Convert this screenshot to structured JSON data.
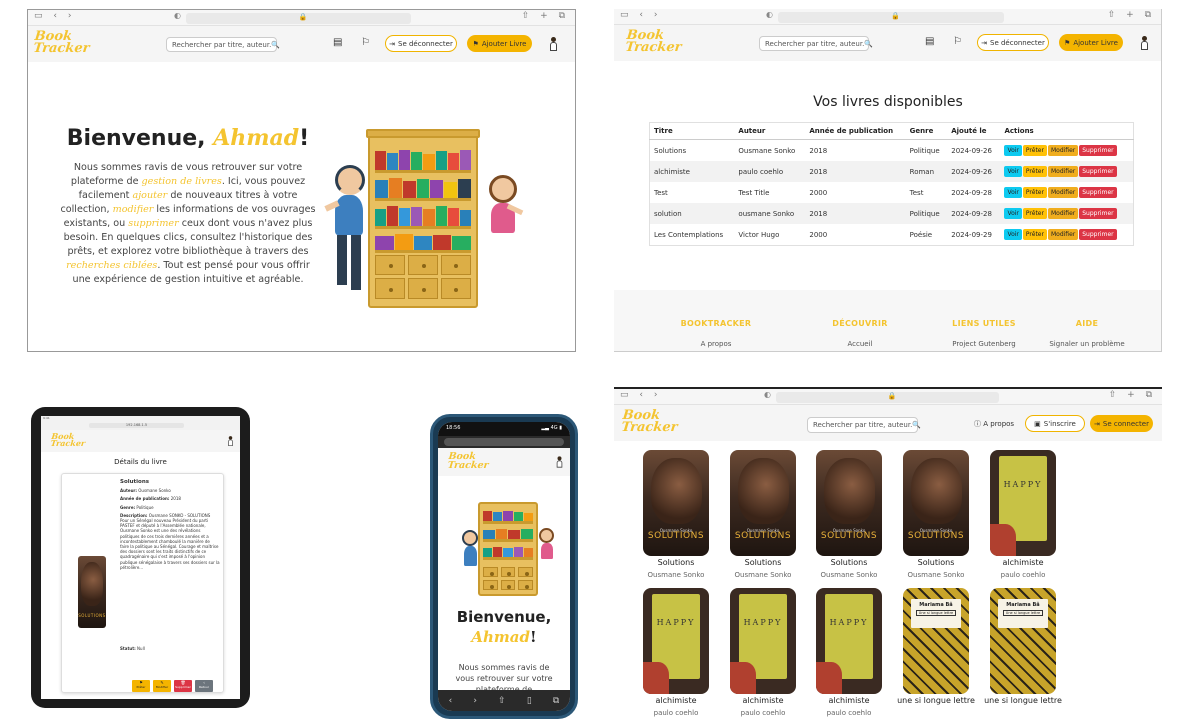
{
  "brand": {
    "logo_line1": "Book",
    "logo_line2": "Tracker",
    "accent": "#f4c430"
  },
  "nav": {
    "search_placeholder": "Rechercher par titre, auteur..",
    "search_placeholder_short": "Rechercher par titre, auteur.",
    "logout_label": "Se déconnecter",
    "add_book_label": "Ajouter Livre",
    "about_label": "A propos",
    "signup_label": "S'inscrire",
    "login_label": "Se connecter"
  },
  "home": {
    "greeting": "Bienvenue, ",
    "user_name": "Ahmad",
    "exclaim": "!",
    "intro": [
      {
        "t": "Nous sommes ravis de vous retrouver sur votre plateforme de ",
        "em": false
      },
      {
        "t": "gestion de livres",
        "em": true
      },
      {
        "t": ". Ici, vous pouvez facilement ",
        "em": false
      },
      {
        "t": "ajouter",
        "em": true
      },
      {
        "t": " de nouveaux titres à votre collection, ",
        "em": false
      },
      {
        "t": "modifier",
        "em": true
      },
      {
        "t": " les informations de vos ouvrages existants, ou ",
        "em": false
      },
      {
        "t": "supprimer",
        "em": true
      },
      {
        "t": " ceux dont vous n'avez plus besoin. En quelques clics, consultez l'historique des prêts, et explorez votre bibliothèque à travers des ",
        "em": false
      },
      {
        "t": "recherches ciblées",
        "em": true
      },
      {
        "t": ". Tout est pensé pour vous offrir une expérience de gestion intuitive et agréable.",
        "em": false
      }
    ]
  },
  "books_page": {
    "title": "Vos livres disponibles",
    "columns": [
      "Titre",
      "Auteur",
      "Année de publication",
      "Genre",
      "Ajouté le",
      "Actions"
    ],
    "actions": {
      "view": "Voir",
      "lend": "Prêter",
      "edit": "Modifier",
      "delete": "Supprimer"
    },
    "rows": [
      [
        "Solutions",
        "Ousmane Sonko",
        "2018",
        "Politique",
        "2024-09-26"
      ],
      [
        "alchimiste",
        "paulo coehlo",
        "2018",
        "Roman",
        "2024-09-26"
      ],
      [
        "Test",
        "Test Title",
        "2000",
        "Test",
        "2024-09-28"
      ],
      [
        "solution",
        "ousmane Sonko",
        "2018",
        "Politique",
        "2024-09-28"
      ],
      [
        "Les Contemplations",
        "Victor Hugo",
        "2000",
        "Poésie",
        "2024-09-29"
      ]
    ]
  },
  "footer": {
    "columns": [
      {
        "heading": "BOOKTRACKER",
        "link": "A propos"
      },
      {
        "heading": "DÉCOUVRIR",
        "link": "Accueil"
      },
      {
        "heading": "LIENS UTILES",
        "link": "Project Gutenberg"
      },
      {
        "heading": "AIDE",
        "link": "Signaler un problème"
      }
    ]
  },
  "catalog": {
    "row1": [
      {
        "title": "Solutions",
        "author": "Ousmane Sonko",
        "cover": "solutions"
      },
      {
        "title": "Solutions",
        "author": "Ousmane Sonko",
        "cover": "solutions"
      },
      {
        "title": "Solutions",
        "author": "Ousmane Sonko",
        "cover": "solutions"
      },
      {
        "title": "Solutions",
        "author": "Ousmane Sonko",
        "cover": "solutions"
      },
      {
        "title": "alchimiste",
        "author": "paulo coehlo",
        "cover": "happy"
      }
    ],
    "row2": [
      {
        "title": "alchimiste",
        "author": "paulo coehlo",
        "cover": "happy"
      },
      {
        "title": "alchimiste",
        "author": "paulo coehlo",
        "cover": "happy"
      },
      {
        "title": "alchimiste",
        "author": "paulo coehlo",
        "cover": "happy"
      },
      {
        "title": "une si longue lettre",
        "author": "",
        "cover": "mariama"
      },
      {
        "title": "une si longue lettre",
        "author": "",
        "cover": "mariama"
      }
    ],
    "cover_texts": {
      "solutions_title": "SOLUTIONS",
      "solutions_author": "Ousmane Sonko",
      "happy_title": "HAPPY",
      "mariama_author": "Mariama Bâ",
      "mariama_sub": "Une si longue lettre"
    }
  },
  "tablet": {
    "page_title": "Détails du livre",
    "book_title": "Solutions",
    "author_label": "Auteur:",
    "author": "Ousmane Sonko",
    "year_label": "Année de publication:",
    "year": "2018",
    "genre_label": "Genre:",
    "genre": "Politique",
    "desc_label": "Description:",
    "description": "Ousmane SONKO - SOLUTIONS Pour un Sénégal nouveau Président du parti PASTEF et député à l'Assemblée nationale, Ousmane Sonko est une des révélations politiques de ces trois dernières années et a incontestablement chamboulé la manière de faire la politique au Sénégal. Courage et maîtrise des dossiers sont les traits distinctifs de ce quadragénaire qui s'est imposé à l'opinion publique sénégalaise à travers ses dossiers sur la pétrolière...",
    "status_label": "Statut:",
    "status": "Null",
    "buttons": [
      "Prêter",
      "Modifier",
      "Supprimer",
      "Retour"
    ],
    "url": "192.168.1.5"
  },
  "phone": {
    "time": "18:56",
    "greeting": "Bienvenue,",
    "user_name": "Ahmad",
    "exclaim": "!",
    "intro": "Nous sommes ravis de vous retrouver sur votre plateforme de"
  }
}
